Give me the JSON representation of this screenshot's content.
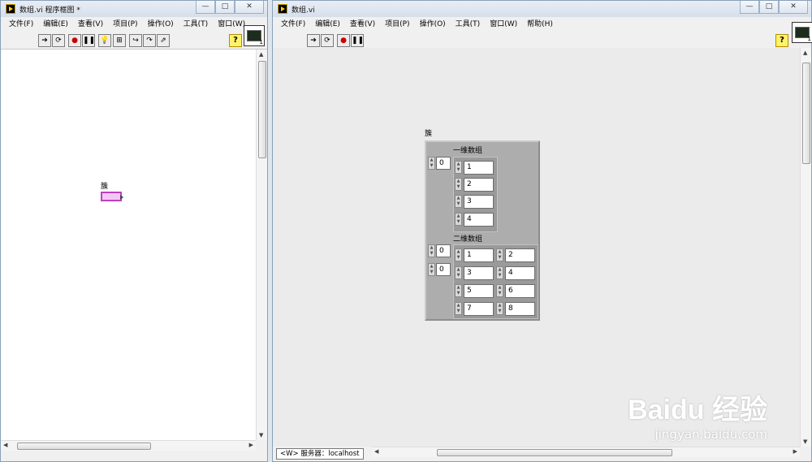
{
  "left_window": {
    "title": "数组.vi 程序框图 *",
    "menu": [
      "文件(F)",
      "编辑(E)",
      "查看(V)",
      "项目(P)",
      "操作(O)",
      "工具(T)",
      "窗口(W)"
    ],
    "node_label": "簇",
    "vi_icon_num": "1"
  },
  "right_window": {
    "title": "数组.vi",
    "menu": [
      "文件(F)",
      "编辑(E)",
      "查看(V)",
      "项目(P)",
      "操作(O)",
      "工具(T)",
      "窗口(W)",
      "帮助(H)"
    ],
    "vi_icon_num": "1",
    "status": "<W> 服务器：localhost"
  },
  "cluster": {
    "label": "簇",
    "array1": {
      "label": "一维数组",
      "index": "0",
      "values": [
        "1",
        "2",
        "3",
        "4"
      ]
    },
    "array2": {
      "label": "二维数组",
      "row_index": "0",
      "col_index": "0",
      "values": [
        [
          "1",
          "2"
        ],
        [
          "3",
          "4"
        ],
        [
          "5",
          "6"
        ],
        [
          "7",
          "8"
        ]
      ]
    }
  },
  "watermark": {
    "brand": "Baidu 经验",
    "url": "jingyan.baidu.com"
  },
  "colors": {
    "cluster_bg": "#adadad",
    "node_border": "#c040c0",
    "help_yellow": "#fff36a"
  },
  "icons": [
    "run-arrow-icon",
    "run-continuous-icon",
    "abort-icon",
    "pause-icon",
    "highlight-execution-icon",
    "retain-wire-icon",
    "step-into-icon",
    "step-over-icon",
    "step-out-icon",
    "help-icon"
  ]
}
